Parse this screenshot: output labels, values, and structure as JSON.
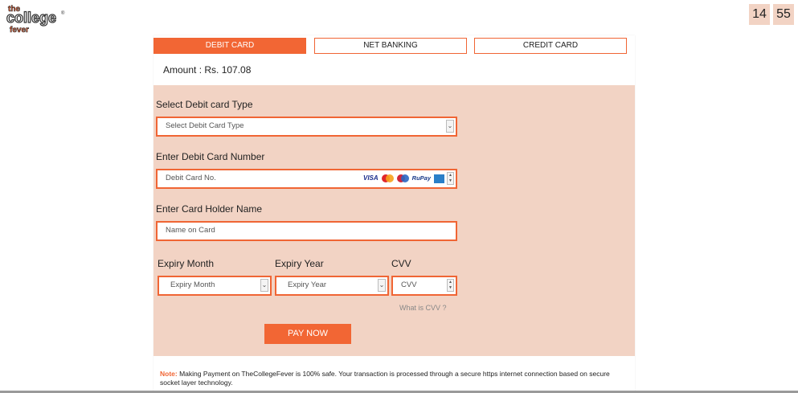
{
  "header": {
    "logo_word_top": "the",
    "logo_word_main": "college",
    "logo_word_bottom": "fever",
    "logo_mark": "®",
    "timer_minutes": "14",
    "timer_seconds": "55"
  },
  "tabs": [
    {
      "label": "DEBIT CARD",
      "active": true
    },
    {
      "label": "NET BANKING",
      "active": false
    },
    {
      "label": "CREDIT CARD",
      "active": false
    }
  ],
  "amount_text": "Amount : Rs. 107.08",
  "form": {
    "card_type_label": "Select Debit card Type",
    "card_type_placeholder": "Select Debit Card Type",
    "card_number_label": "Enter Debit Card Number",
    "card_number_placeholder": "Debit Card No.",
    "card_logos": [
      "VISA",
      "RuPay"
    ],
    "holder_label": "Enter Card Holder Name",
    "holder_placeholder": "Name on Card",
    "expiry_month_label": "Expiry Month",
    "expiry_month_placeholder": "Expiry Month",
    "expiry_year_label": "Expiry Year",
    "expiry_year_placeholder": "Expiry Year",
    "cvv_label": "CVV",
    "cvv_placeholder": "CVV",
    "cvv_help": "What is CVV ?",
    "pay_button": "PAY NOW"
  },
  "note": {
    "label": "Note:",
    "text": " Making Payment on TheCollegeFever is 100% safe. Your transaction is processed through a secure https internet connection based on secure socket layer technology."
  },
  "colors": {
    "accent": "#f26634",
    "form_bg": "#f2d3c4"
  }
}
